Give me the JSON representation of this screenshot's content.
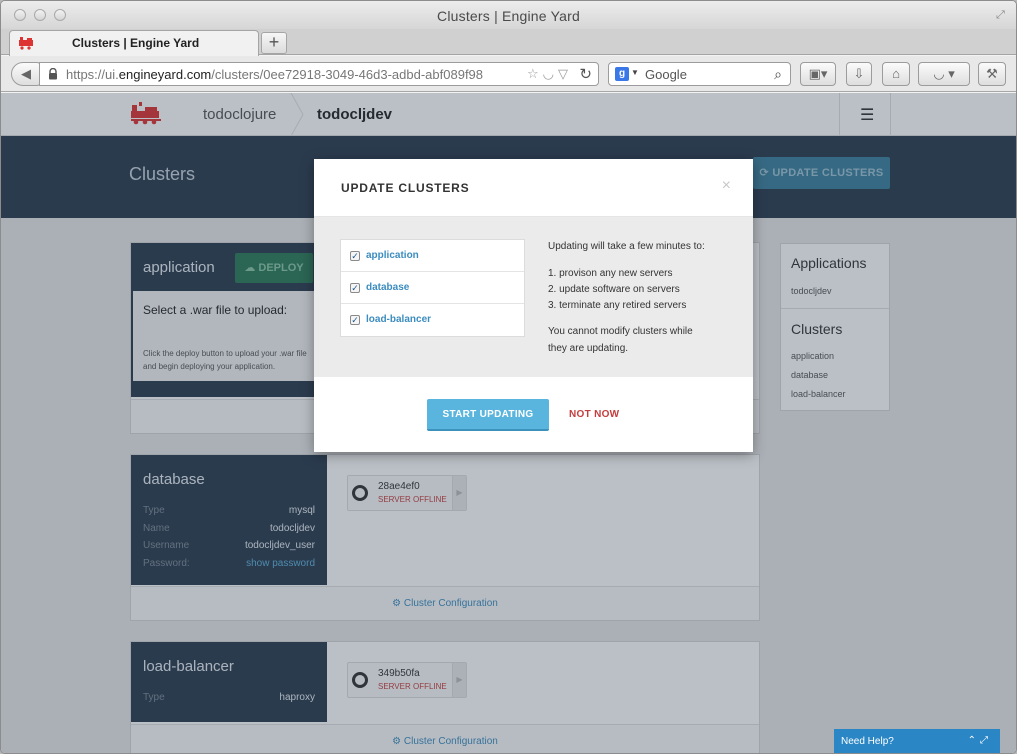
{
  "browser": {
    "window_title": "Clusters | Engine Yard",
    "tab_title": "Clusters | Engine Yard",
    "url_prefix": "https://ui.",
    "url_domain": "engineyard.com",
    "url_path": "/clusters/0ee72918-3049-46d3-adbd-abf089f98",
    "search_placeholder": "Google"
  },
  "header": {
    "breadcrumb_account": "todoclojure",
    "breadcrumb_env": "todocljdev"
  },
  "hero": {
    "title": "Clusters",
    "update_button": "UPDATE CLUSTERS"
  },
  "clusters": {
    "application": {
      "name": "application",
      "deploy_label": "DEPLOY",
      "war_title": "Select a .war file to upload:",
      "war_desc": "Click the deploy button to upload your .war file and begin deploying your application."
    },
    "database": {
      "name": "database",
      "fields": [
        {
          "key": "Type",
          "value": "mysql"
        },
        {
          "key": "Name",
          "value": "todocljdev"
        },
        {
          "key": "Username",
          "value": "todocljdev_user"
        },
        {
          "key": "Password:",
          "value": "show password"
        }
      ],
      "server_id": "28ae4ef0",
      "server_status": "SERVER OFFLINE",
      "config_link": "Cluster Configuration"
    },
    "load_balancer": {
      "name": "load-balancer",
      "fields": [
        {
          "key": "Type",
          "value": "haproxy"
        }
      ],
      "server_id": "349b50fa",
      "server_status": "SERVER OFFLINE",
      "config_link": "Cluster Configuration"
    }
  },
  "right_panel": {
    "applications_heading": "Applications",
    "applications": [
      "todocljdev"
    ],
    "clusters_heading": "Clusters",
    "clusters": [
      "application",
      "database",
      "load-balancer"
    ]
  },
  "help": {
    "label": "Need Help?"
  },
  "modal": {
    "title": "UPDATE CLUSTERS",
    "close": "×",
    "checks": [
      {
        "label": "application",
        "checked": true
      },
      {
        "label": "database",
        "checked": true
      },
      {
        "label": "load-balancer",
        "checked": true
      }
    ],
    "intro": "Updating will take a few minutes to:",
    "steps": [
      "1.  provison any new servers",
      "2.  update software on servers",
      "3.  terminate any retired servers"
    ],
    "warning_line1": "You cannot modify clusters while",
    "warning_line2": "they are updating.",
    "start_button": "START UPDATING",
    "cancel_button": "NOT NOW"
  },
  "colors": {
    "navy": "#2b3c4e",
    "accent_blue": "#5ab5de",
    "danger_red": "#c43d3d"
  }
}
